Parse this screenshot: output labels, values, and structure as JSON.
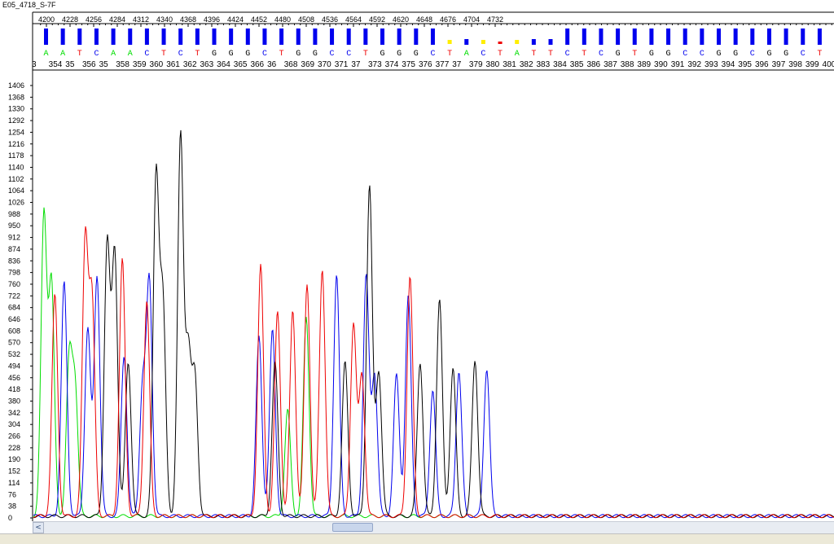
{
  "window": {
    "title": "E05_4718_S-7F"
  },
  "colors": {
    "A": "#00dd00",
    "C": "#0000ee",
    "G": "#000000",
    "T": "#ee0000",
    "N": "#ffee00",
    "qv_high": "#0000ee",
    "qv_red": "#ee0000",
    "qv_yellow": "#ffee00"
  },
  "scroll": {
    "left_arrow": "<"
  },
  "chart_data": {
    "type": "line",
    "title": "",
    "xlabel": "",
    "ylabel": "",
    "x_scan_ticks": [
      "4200",
      "4228",
      "4256",
      "4284",
      "4312",
      "4340",
      "4368",
      "4396",
      "4424",
      "4452",
      "4480",
      "4508",
      "4536",
      "4564",
      "4592",
      "4620",
      "4648",
      "4676",
      "4704",
      "4732"
    ],
    "y_ticks": [
      "1406",
      "1368",
      "1330",
      "1292",
      "1254",
      "1216",
      "1178",
      "1140",
      "1102",
      "1064",
      "1026",
      "988",
      "950",
      "912",
      "874",
      "836",
      "798",
      "760",
      "722",
      "684",
      "646",
      "608",
      "570",
      "532",
      "494",
      "456",
      "418",
      "380",
      "342",
      "304",
      "266",
      "228",
      "190",
      "152",
      "114",
      "76",
      "38",
      "0"
    ],
    "ylim": [
      0,
      1406
    ],
    "base_calls": [
      "A",
      "A",
      "T",
      "C",
      "A",
      "A",
      "C",
      "T",
      "C",
      "T",
      "G",
      "G",
      "G",
      "C",
      "T",
      "G",
      "G",
      "C",
      "C",
      "T",
      "G",
      "G",
      "G",
      "C",
      "T",
      "A",
      "C",
      "T",
      "A",
      "T",
      "T",
      "C",
      "T",
      "C",
      "G",
      "T",
      "G",
      "G",
      "C",
      "C",
      "G",
      "G",
      "C",
      "G",
      "G",
      "C",
      "T"
    ],
    "base_numbers": [
      "3",
      "354",
      "35",
      "356",
      "35",
      "358",
      "359",
      "360",
      "361",
      "362",
      "363",
      "364",
      "365",
      "366",
      "36",
      "368",
      "369",
      "370",
      "371",
      "37",
      "373",
      "374",
      "375",
      "376",
      "377",
      "37",
      "379",
      "380",
      "381",
      "382",
      "383",
      "384",
      "385",
      "386",
      "387",
      "388",
      "389",
      "390",
      "391",
      "392",
      "393",
      "394",
      "395",
      "396",
      "397",
      "398",
      "399",
      "400"
    ],
    "series": [
      {
        "name": "A",
        "peaks": [
          [
            4197,
            980
          ],
          [
            4206,
            757
          ],
          [
            4227,
            500
          ],
          [
            4234,
            410
          ],
          [
            4486,
            345
          ],
          [
            4508,
            647
          ]
        ]
      },
      {
        "name": "C",
        "peaks": [
          [
            4221,
            760
          ],
          [
            4249,
            610
          ],
          [
            4260,
            782
          ],
          [
            4292,
            522
          ],
          [
            4314,
            415
          ],
          [
            4322,
            760
          ],
          [
            4452,
            583
          ],
          [
            4468,
            605
          ],
          [
            4544,
            785
          ],
          [
            4579,
            780
          ],
          [
            4589,
            460
          ],
          [
            4615,
            460
          ],
          [
            4629,
            715
          ],
          [
            4658,
            410
          ],
          [
            4689,
            472
          ],
          [
            4722,
            479
          ]
        ]
      },
      {
        "name": "G",
        "peaks": [
          [
            4272,
            885
          ],
          [
            4281,
            855
          ],
          [
            4297,
            500
          ],
          [
            4330,
            1100
          ],
          [
            4338,
            690
          ],
          [
            4359,
            1236
          ],
          [
            4368,
            532
          ],
          [
            4376,
            450
          ],
          [
            4471,
            500
          ],
          [
            4554,
            500
          ],
          [
            4583,
            1075
          ],
          [
            4594,
            470
          ],
          [
            4643,
            500
          ],
          [
            4666,
            704
          ],
          [
            4682,
            480
          ],
          [
            4708,
            508
          ]
        ]
      },
      {
        "name": "T",
        "peaks": [
          [
            4210,
            720
          ],
          [
            4246,
            893
          ],
          [
            4254,
            700
          ],
          [
            4290,
            835
          ],
          [
            4319,
            700
          ],
          [
            4454,
            815
          ],
          [
            4474,
            665
          ],
          [
            4492,
            670
          ],
          [
            4509,
            755
          ],
          [
            4527,
            805
          ],
          [
            4564,
            625
          ],
          [
            4574,
            460
          ],
          [
            4631,
            780
          ]
        ]
      }
    ]
  }
}
